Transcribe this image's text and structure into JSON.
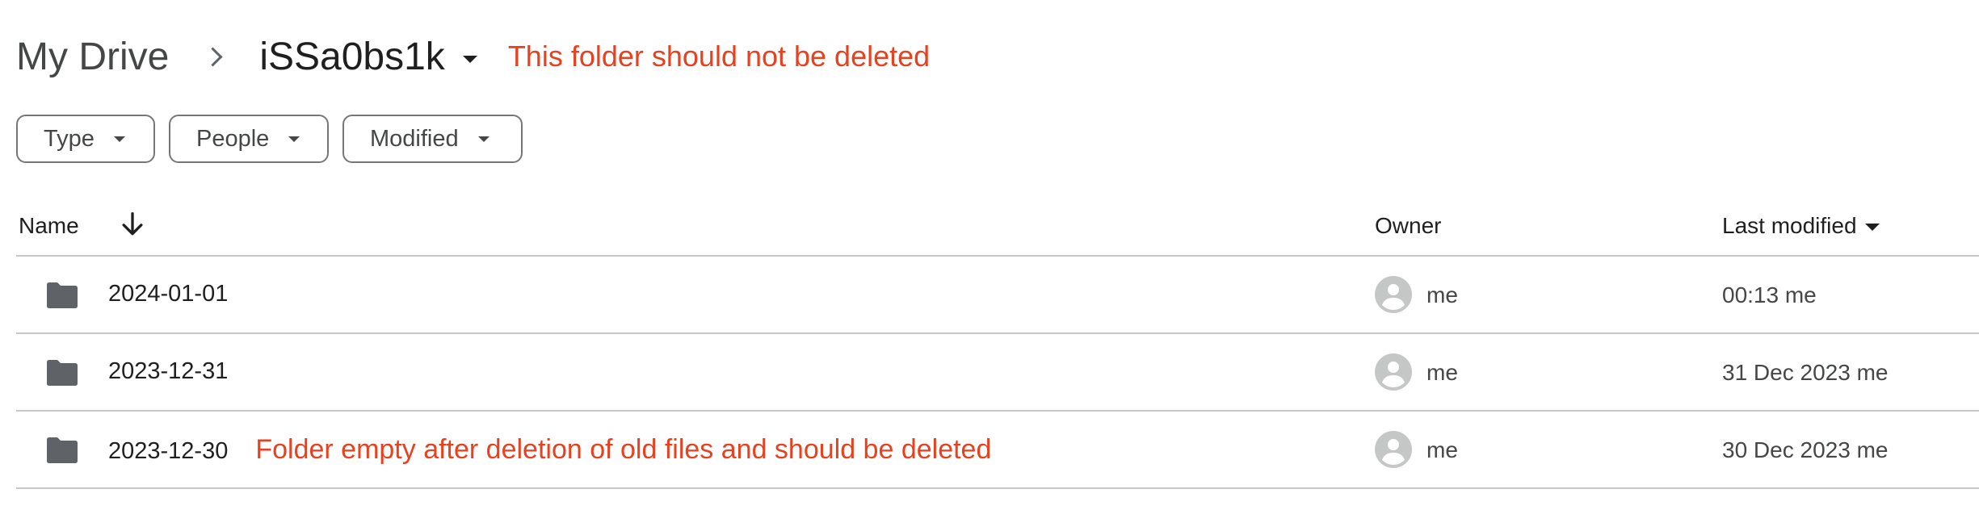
{
  "breadcrumb": {
    "root": "My Drive",
    "current": "iSSa0bs1k",
    "note": "This folder should not be deleted"
  },
  "filters": [
    {
      "label": "Type"
    },
    {
      "label": "People"
    },
    {
      "label": "Modified"
    }
  ],
  "table": {
    "columns": {
      "name": "Name",
      "owner": "Owner",
      "last_modified": "Last modified"
    },
    "rows": [
      {
        "name": "2024-01-01",
        "note": "",
        "owner": "me",
        "modified": "00:13 me"
      },
      {
        "name": "2023-12-31",
        "note": "",
        "owner": "me",
        "modified": "31 Dec 2023 me"
      },
      {
        "name": "2023-12-30",
        "note": "Folder empty after deletion of old files and should be deleted",
        "owner": "me",
        "modified": "30 Dec 2023 me"
      }
    ]
  },
  "colors": {
    "annotation": "#e8411f",
    "folder": "#5f6368",
    "avatar": "#c4c7c5",
    "divider": "#c4c7c5"
  },
  "icons": {
    "separator": "chevron-right-icon",
    "sort": "arrow-down-icon",
    "folder": "folder-icon",
    "avatar": "account-circle-icon"
  }
}
